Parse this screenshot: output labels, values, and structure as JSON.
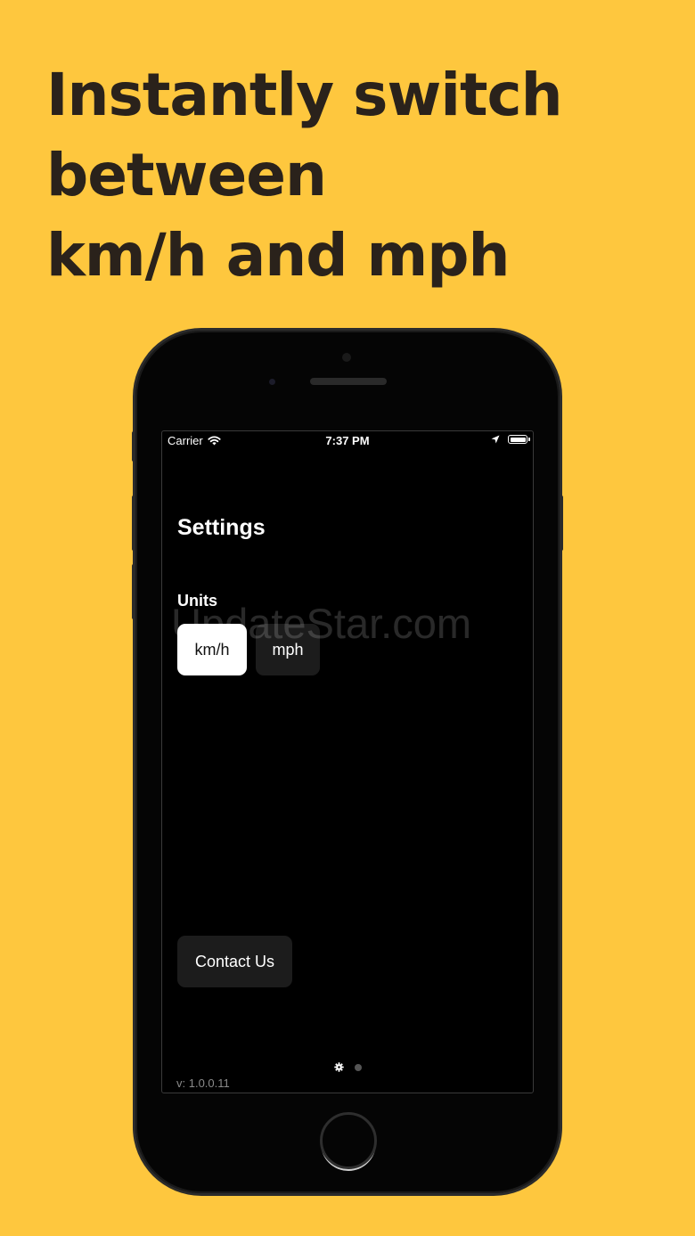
{
  "headline": {
    "lines": [
      "Instantly switch",
      "between",
      "km/h and mph"
    ]
  },
  "status_bar": {
    "carrier": "Carrier",
    "time": "7:37 PM"
  },
  "screen": {
    "title": "Settings",
    "units_label": "Units",
    "watermark": "UpdateStar.com",
    "units": [
      {
        "label": "km/h",
        "selected": true
      },
      {
        "label": "mph",
        "selected": false
      }
    ],
    "contact_label": "Contact Us",
    "version": "v: 1.0.0.11",
    "page_indicator": {
      "pages": 2,
      "current": 1
    }
  },
  "colors": {
    "background": "#FEC73E",
    "headline": "#2A221B",
    "selected_button": "#FFFFFF",
    "unselected_button": "#1C1C1C"
  },
  "icons": [
    "wifi-icon",
    "location-arrow-icon",
    "battery-icon",
    "gear-icon"
  ]
}
